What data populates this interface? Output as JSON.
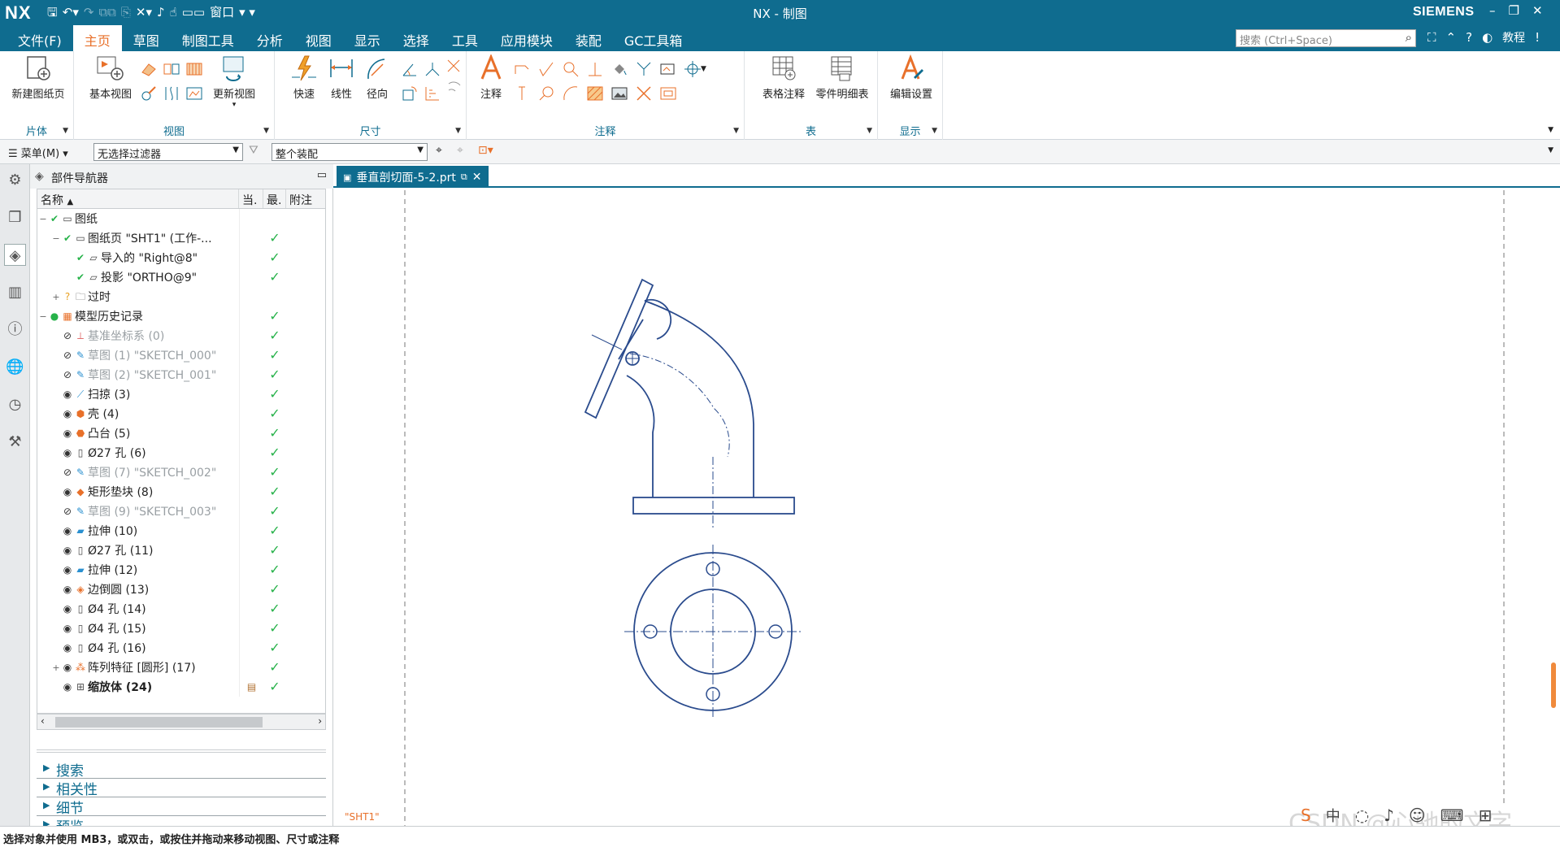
{
  "titlebar": {
    "logo": "NX",
    "title": "NX - 制图",
    "brand": "SIEMENS",
    "window_menu": "窗口"
  },
  "menu": {
    "tabs": [
      "文件(F)",
      "主页",
      "草图",
      "制图工具",
      "分析",
      "视图",
      "显示",
      "选择",
      "工具",
      "应用模块",
      "装配",
      "GC工具箱"
    ],
    "search_placeholder": "搜索 (Ctrl+Space)",
    "tutorial": "教程"
  },
  "ribbon": {
    "groups": [
      {
        "label": "片体"
      },
      {
        "label": "视图"
      },
      {
        "label": "尺寸"
      },
      {
        "label": "注释"
      },
      {
        "label": "表"
      },
      {
        "label": "显示"
      }
    ],
    "buttons": {
      "new_sheet": "新建图纸页",
      "base_view": "基本视图",
      "update_view": "更新视图",
      "rapid": "快速",
      "linear": "线性",
      "radial": "径向",
      "note": "注释",
      "tabular_note": "表格注释",
      "parts_list": "零件明细表",
      "edit_settings": "编辑设置"
    }
  },
  "cmdbar": {
    "menu": "菜单(M)",
    "filter": "无选择过滤器",
    "scope": "整个装配"
  },
  "navigator": {
    "title": "部件导航器",
    "columns": [
      "名称",
      "当.",
      "最.",
      "附注"
    ],
    "rows": [
      {
        "label": "图纸",
        "indent": 0,
        "exp": "−",
        "check": true,
        "ok": false,
        "grey": false,
        "bold": false,
        "icon": "sheet-icon"
      },
      {
        "label": "图纸页 \"SHT1\" (工作-...",
        "indent": 1,
        "exp": "−",
        "check": true,
        "ok": true,
        "grey": false,
        "bold": false,
        "icon": "sheet-icon"
      },
      {
        "label": "导入的 \"Right@8\"",
        "indent": 2,
        "exp": "",
        "check": true,
        "ok": true,
        "grey": false,
        "bold": false,
        "icon": "view-icon"
      },
      {
        "label": "投影 \"ORTHO@9\"",
        "indent": 2,
        "exp": "",
        "check": true,
        "ok": true,
        "grey": false,
        "bold": false,
        "icon": "view-icon"
      },
      {
        "label": "过时",
        "indent": 1,
        "exp": "+",
        "check": false,
        "ok": false,
        "grey": false,
        "bold": false,
        "icon": "folder-icon"
      },
      {
        "label": "模型历史记录",
        "indent": 0,
        "exp": "−",
        "check": false,
        "ok": true,
        "grey": false,
        "bold": false,
        "icon": "history-icon"
      },
      {
        "label": "基准坐标系 (0)",
        "indent": 1,
        "exp": "",
        "check": false,
        "ok": true,
        "grey": true,
        "bold": false,
        "icon": "csys-icon"
      },
      {
        "label": "草图 (1) \"SKETCH_000\"",
        "indent": 1,
        "exp": "",
        "check": false,
        "ok": true,
        "grey": true,
        "bold": false,
        "icon": "sketch-icon"
      },
      {
        "label": "草图 (2) \"SKETCH_001\"",
        "indent": 1,
        "exp": "",
        "check": false,
        "ok": true,
        "grey": true,
        "bold": false,
        "icon": "sketch-icon"
      },
      {
        "label": "扫掠 (3)",
        "indent": 1,
        "exp": "",
        "check": false,
        "ok": true,
        "grey": false,
        "bold": false,
        "icon": "sweep-icon"
      },
      {
        "label": "壳 (4)",
        "indent": 1,
        "exp": "",
        "check": false,
        "ok": true,
        "grey": false,
        "bold": false,
        "icon": "shell-icon"
      },
      {
        "label": "凸台 (5)",
        "indent": 1,
        "exp": "",
        "check": false,
        "ok": true,
        "grey": false,
        "bold": false,
        "icon": "boss-icon"
      },
      {
        "label": "Ø27 孔 (6)",
        "indent": 1,
        "exp": "",
        "check": false,
        "ok": true,
        "grey": false,
        "bold": false,
        "icon": "hole-icon"
      },
      {
        "label": "草图 (7) \"SKETCH_002\"",
        "indent": 1,
        "exp": "",
        "check": false,
        "ok": true,
        "grey": true,
        "bold": false,
        "icon": "sketch-icon"
      },
      {
        "label": "矩形垫块 (8)",
        "indent": 1,
        "exp": "",
        "check": false,
        "ok": true,
        "grey": false,
        "bold": false,
        "icon": "pad-icon"
      },
      {
        "label": "草图 (9) \"SKETCH_003\"",
        "indent": 1,
        "exp": "",
        "check": false,
        "ok": true,
        "grey": true,
        "bold": false,
        "icon": "sketch-icon"
      },
      {
        "label": "拉伸 (10)",
        "indent": 1,
        "exp": "",
        "check": false,
        "ok": true,
        "grey": false,
        "bold": false,
        "icon": "extrude-icon"
      },
      {
        "label": "Ø27 孔 (11)",
        "indent": 1,
        "exp": "",
        "check": false,
        "ok": true,
        "grey": false,
        "bold": false,
        "icon": "hole-icon"
      },
      {
        "label": "拉伸 (12)",
        "indent": 1,
        "exp": "",
        "check": false,
        "ok": true,
        "grey": false,
        "bold": false,
        "icon": "extrude-icon"
      },
      {
        "label": "边倒圆 (13)",
        "indent": 1,
        "exp": "",
        "check": false,
        "ok": true,
        "grey": false,
        "bold": false,
        "icon": "blend-icon"
      },
      {
        "label": "Ø4 孔 (14)",
        "indent": 1,
        "exp": "",
        "check": false,
        "ok": true,
        "grey": false,
        "bold": false,
        "icon": "hole-icon"
      },
      {
        "label": "Ø4 孔 (15)",
        "indent": 1,
        "exp": "",
        "check": false,
        "ok": true,
        "grey": false,
        "bold": false,
        "icon": "hole-icon"
      },
      {
        "label": "Ø4 孔 (16)",
        "indent": 1,
        "exp": "",
        "check": false,
        "ok": true,
        "grey": false,
        "bold": false,
        "icon": "hole-icon"
      },
      {
        "label": "阵列特征 [圆形] (17)",
        "indent": 1,
        "exp": "+",
        "check": false,
        "ok": true,
        "grey": false,
        "bold": false,
        "icon": "pattern-icon"
      },
      {
        "label": "缩放体 (24)",
        "indent": 1,
        "exp": "",
        "check": false,
        "ok": true,
        "grey": false,
        "bold": true,
        "icon": "scale-icon"
      }
    ],
    "panels": [
      "搜索",
      "相关性",
      "细节",
      "预览"
    ]
  },
  "document": {
    "tab": "垂直剖切面-5-2.prt",
    "sheet_label": "\"SHT1\""
  },
  "status": "选择对象并使用 MB3，或双击，或按住并拖动来移动视图、尺寸或注释",
  "watermark": "CSDN @心驰的文字",
  "colors": {
    "brand": "#0f6c8f",
    "accent": "#e8702a",
    "check": "#27b24a",
    "drawing": "#2a4b8d"
  }
}
